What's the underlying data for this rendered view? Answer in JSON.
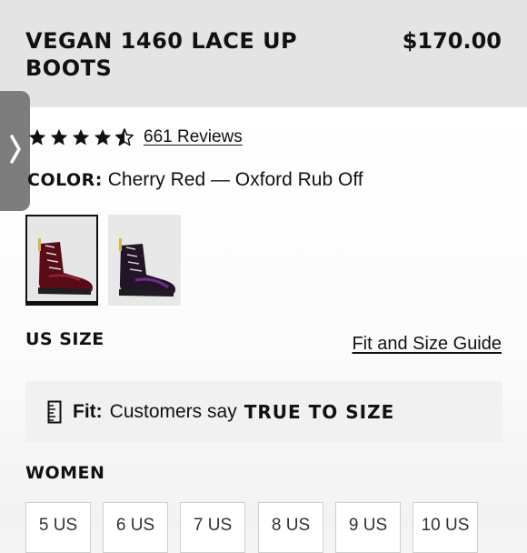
{
  "product": {
    "title": "VEGAN 1460 LACE UP BOOTS",
    "price": "$170.00",
    "rating": 4.5,
    "reviews_label": "661 Reviews"
  },
  "color": {
    "label": "COLOR:",
    "value": "Cherry Red — Oxford Rub Off",
    "swatches": [
      {
        "name": "Cherry Red — Oxford Rub Off",
        "selected": true
      },
      {
        "name": "Purple variant",
        "selected": false
      }
    ]
  },
  "size": {
    "heading": "US SIZE",
    "guide_link": "Fit and Size Guide",
    "fit_label": "Fit:",
    "fit_text": "Customers say",
    "fit_value": "TRUE TO SIZE",
    "women_heading": "WOMEN",
    "women_sizes": [
      "5 US",
      "6 US",
      "7 US",
      "8 US",
      "9 US",
      "10 US"
    ]
  },
  "icons": {
    "side_tab": "chevron-right-icon",
    "fit": "ruler-icon",
    "rating": "star-icon"
  },
  "colors": {
    "header_bg": "#e4e4e4",
    "side_tab": "#7d7d7d",
    "text": "#111111"
  }
}
